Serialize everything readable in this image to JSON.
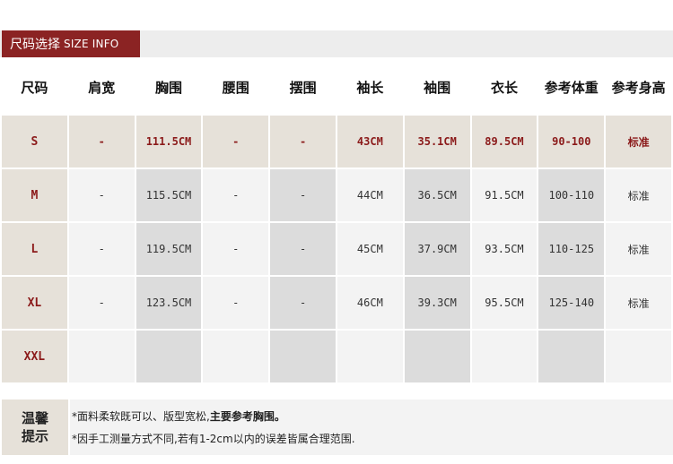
{
  "header": {
    "title_zh": "尺码选择",
    "title_en": "SIZE INFO"
  },
  "table": {
    "headers": [
      "尺码",
      "肩宽",
      "胸围",
      "腰围",
      "摆围",
      "袖长",
      "袖围",
      "衣长",
      "参考体重",
      "参考身高"
    ],
    "rows": [
      {
        "cells": [
          "S",
          "-",
          "111.5CM",
          "-",
          "-",
          "43CM",
          "35.1CM",
          "89.5CM",
          "90-100",
          "标准"
        ]
      },
      {
        "cells": [
          "M",
          "-",
          "115.5CM",
          "-",
          "-",
          "44CM",
          "36.5CM",
          "91.5CM",
          "100-110",
          "标准"
        ]
      },
      {
        "cells": [
          "L",
          "-",
          "119.5CM",
          "-",
          "-",
          "45CM",
          "37.9CM",
          "93.5CM",
          "110-125",
          "标准"
        ]
      },
      {
        "cells": [
          "XL",
          "-",
          "123.5CM",
          "-",
          "-",
          "46CM",
          "39.3CM",
          "95.5CM",
          "125-140",
          "标准"
        ]
      },
      {
        "cells": [
          "XXL",
          "",
          "",
          "",
          "",
          "",
          "",
          "",
          "",
          ""
        ]
      }
    ]
  },
  "notes": {
    "label_line1": "温馨",
    "label_line2": "提示",
    "line1_prefix": "*面料柔软既可以、版型宽松,",
    "line1_emphasis": "主要参考胸围。",
    "line2": "*因手工测量方式不同,若有1-2cm以内的误差皆属合理范围."
  },
  "colors": {
    "brand": "#8b2323",
    "highlight_text": "#8b1a1a",
    "beige_cell": "#e6e1d9",
    "light_cell": "#f3f3f3",
    "dark_cell": "#dcdcdc"
  }
}
